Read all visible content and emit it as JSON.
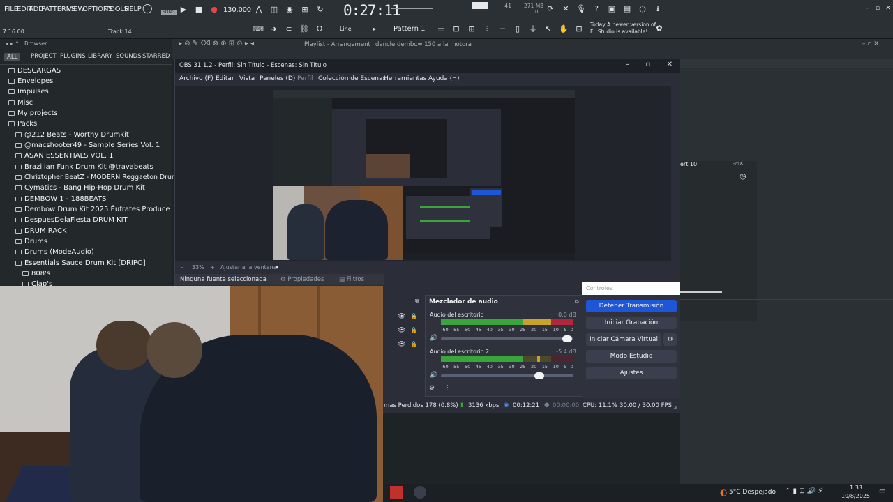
{
  "fl": {
    "menus": [
      "FILE",
      "EDIT",
      "ADD",
      "PATTERNS",
      "VIEW",
      "OPTIONS",
      "TOOLS",
      "HELP"
    ],
    "song_label": "SONG",
    "tempo": "130.000",
    "time": "0:27:11",
    "cpu_mb": "271 MB",
    "cpu_num": "41",
    "cpu_sub": "0",
    "hint_time": "7:16:00",
    "track_label": "Track 14",
    "snap": "Line",
    "pattern": "Pattern 1",
    "news_line1": "Today  A newer version of",
    "news_line2": "FL Studio is available!",
    "browser_title": "Browser",
    "browser_tabs": [
      "ALL",
      "PROJECT",
      "PLUGINS",
      "LIBRARY",
      "SOUNDS",
      "STARRED"
    ],
    "browser_items": [
      "DESCARGAS",
      "Envelopes",
      "Impulses",
      "Misc",
      "My projects",
      "Packs",
      "@212 Beats - Worthy Drumkit",
      "@macshooter49 - Sample Series Vol. 1",
      "ASAN ESSENTIALS VOL. 1",
      "Brazilian Funk Drum Kit @travabeats",
      "Chriztopher BeatZ - MODERN Reggaeton Drum Kit (FREE)",
      "Cymatics - Bang Hip-Hop Drum Kit",
      "DEMBOW 1 - 188BEATS",
      "Dembow Drum Kit 2025 Éufrates Produce",
      "DespuesDelaFiesta DRUM KIT",
      "DRUM RACK",
      "Drums",
      "Drums (ModeAudio)",
      "Essentials Sauce Drum Kit [DRIPO]",
      "808's",
      "Clap's"
    ],
    "playlist_title": "Playlist - Arrangement",
    "playlist_file": "dancle dembow 150 a la motora",
    "mixer_label": "ert 10"
  },
  "obs": {
    "title": "OBS 31.1.2 - Perfil: Sin Título - Escenas: Sin Título",
    "menus": [
      "Archivo (F)",
      "Editar",
      "Vista",
      "Paneles (D)",
      "Perfil",
      "Colección de Escenas",
      "Herramientas",
      "Ayuda (H)"
    ],
    "zoom": "33%",
    "fit_label": "Ajustar a la ventana",
    "no_source": "Ninguna fuente seleccionada",
    "properties": "Propiedades",
    "filters": "Filtros",
    "mixer_title": "Mezclador de audio",
    "channels": [
      {
        "name": "Audio del escritorio",
        "db": "0.0 dB",
        "level": 1.0,
        "vol": 0.94
      },
      {
        "name": "Audio del escritorio 2",
        "db": "-5.4 dB",
        "level": 0.72,
        "vol": 0.74
      }
    ],
    "meter_ticks": [
      "-60",
      "-55",
      "-50",
      "-45",
      "-40",
      "-35",
      "-30",
      "-25",
      "-20",
      "-15",
      "-10",
      "-5",
      "0"
    ],
    "controls_title": "Controles",
    "buttons": [
      "Detener Transmisión",
      "Iniciar Grabación",
      "Iniciar Cámara Virtual",
      "Modo Estudio",
      "Ajustes"
    ],
    "status": {
      "dropped": "mas Perdidos 178 (0.8%)",
      "bitrate": "3136 kbps",
      "live": "00:12:21",
      "rec": "00:00:00",
      "cpu": "CPU: 11.1%",
      "fps": "30.00 / 30.00 FPS"
    }
  },
  "taskbar": {
    "weather": "5°C  Despejado",
    "clock": "1:33",
    "date": "10/8/2025"
  },
  "colors": {
    "accent": "#1e56d8",
    "fl_bg": "#2b3034",
    "obs_bg": "#2b2e38",
    "meter_green": "#3aa53a",
    "meter_yellow": "#c9a22a",
    "meter_red": "#b3263a"
  }
}
